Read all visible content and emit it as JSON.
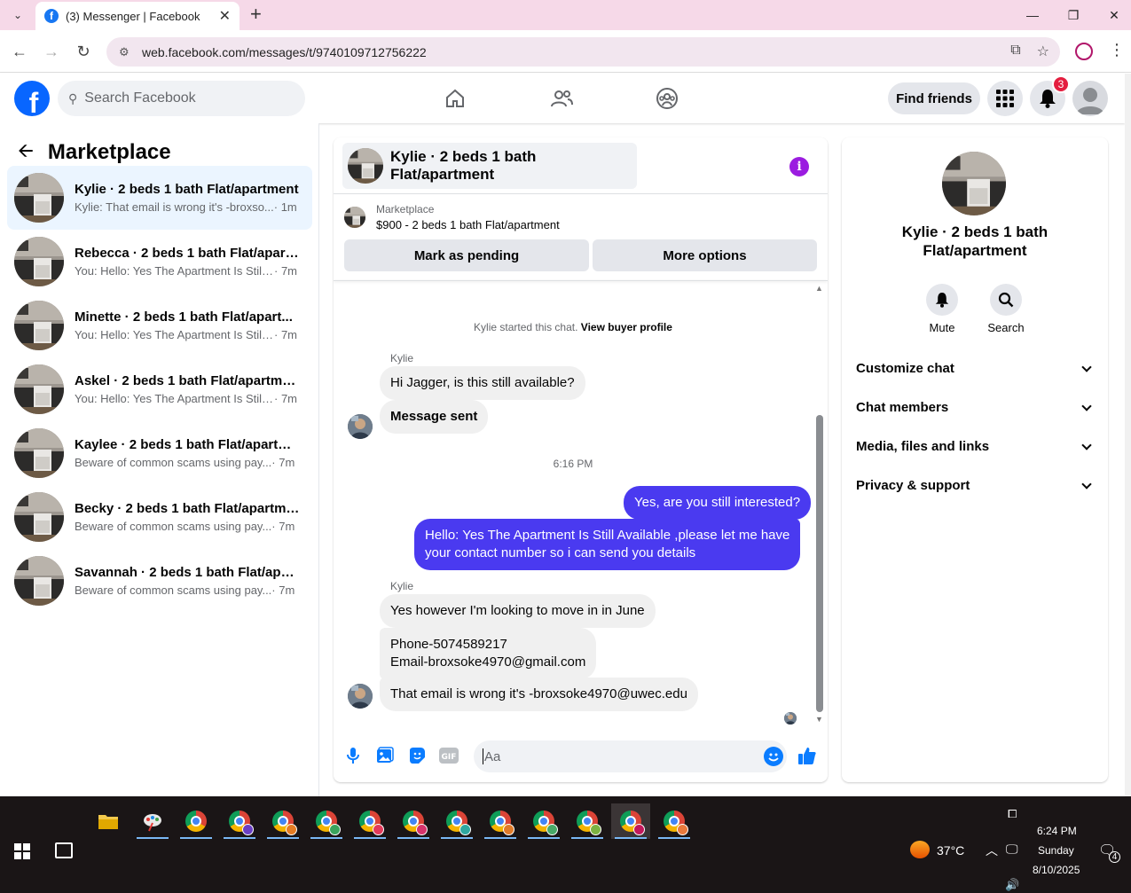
{
  "browser": {
    "tab_title": "(3) Messenger | Facebook",
    "url": "web.facebook.com/messages/t/9740109712756222"
  },
  "fb": {
    "search_placeholder": "Search Facebook",
    "find_friends": "Find friends",
    "notif_count": "3"
  },
  "left": {
    "title": "Marketplace",
    "conversations": [
      {
        "name": "Kylie · 2 beds 1 bath Flat/apartment",
        "snippet": "Kylie: That email is wrong it's -broxso...",
        "time": " · 1m"
      },
      {
        "name": "Rebecca · 2 beds 1 bath Flat/apart...",
        "snippet": "You: Hello: Yes The Apartment Is Still ...",
        "time": " · 7m"
      },
      {
        "name": "Minette · 2 beds 1 bath Flat/apart...",
        "snippet": "You: Hello: Yes The Apartment Is Still ...",
        "time": " · 7m"
      },
      {
        "name": "Askel · 2 beds 1 bath Flat/apartment",
        "snippet": "You: Hello: Yes The Apartment Is Still ...",
        "time": " · 7m"
      },
      {
        "name": "Kaylee · 2 beds 1 bath Flat/apartm...",
        "snippet": "Beware of common scams using pay...",
        "time": " · 7m"
      },
      {
        "name": "Becky · 2 beds 1 bath Flat/apartment",
        "snippet": "Beware of common scams using pay...",
        "time": " · 7m"
      },
      {
        "name": "Savannah · 2 beds 1 bath Flat/apar...",
        "snippet": "Beware of common scams using pay...",
        "time": " · 7m"
      }
    ]
  },
  "chat": {
    "header_name": "Kylie · 2 beds 1 bath Flat/apartment",
    "listing_label": "Marketplace",
    "listing_title": "$900 - 2 beds 1 bath Flat/apartment",
    "mark_pending": "Mark as pending",
    "more_options": "More options",
    "started_text": "Kylie started this chat.",
    "view_profile": "View buyer profile",
    "sender1": "Kylie",
    "msg1": "Hi Jagger, is this still available?",
    "msg2": "Message sent",
    "timestamp": "6:16 PM",
    "me1": "Yes, are you still interested?",
    "me2_line1": "Hello: Yes The Apartment Is Still Available ,please let me have",
    "me2_line2": "your contact number so i can send you details",
    "sender2": "Kylie",
    "msg3": "Yes however I'm looking to move in in June",
    "msg4_line1": "Phone-5074589217",
    "msg4_line2": "Email-broxsoke4970@gmail.com",
    "msg5": "That email is wrong it's -broxsoke4970@uwec.edu",
    "composer_placeholder": "Aa"
  },
  "right": {
    "name_line1": "Kylie · 2 beds 1 bath",
    "name_line2": "Flat/apartment",
    "mute": "Mute",
    "search": "Search",
    "sections": [
      "Customize chat",
      "Chat members",
      "Media, files and links",
      "Privacy & support"
    ]
  },
  "taskbar": {
    "temperature": "37°C",
    "time": "6:24 PM",
    "day": "Sunday",
    "date": "8/10/2025",
    "notification_count": "4"
  },
  "colors": {
    "fb_blue": "#0866ff",
    "my_bubble": "#4a3af0",
    "info_purple": "#9b1ce0",
    "badge_red": "#e41e3f"
  }
}
